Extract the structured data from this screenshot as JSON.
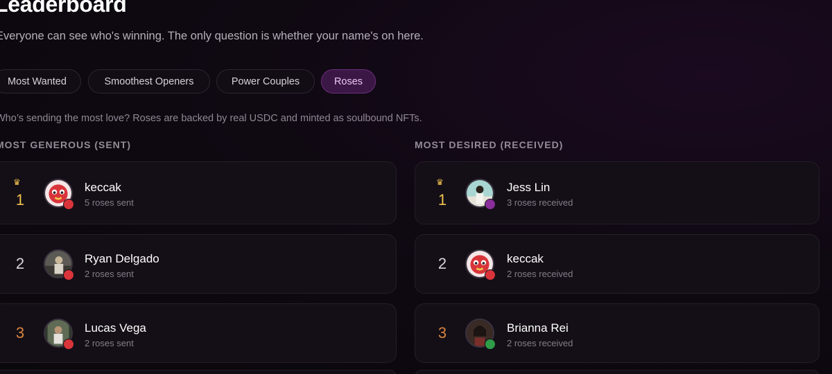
{
  "header": {
    "title": "Leaderboard",
    "subtitle": "Everyone can see who's winning. The only question is whether your name's on here."
  },
  "tabs": [
    {
      "label": "Most Wanted",
      "active": false
    },
    {
      "label": "Smoothest Openers",
      "active": false
    },
    {
      "label": "Power Couples",
      "active": false
    },
    {
      "label": "Roses",
      "active": true
    }
  ],
  "description": "Who’s sending the most love? Roses are backed by real USDC and minted as soulbound NFTs.",
  "sent": {
    "heading": "MOST GENEROUS (SENT)",
    "entries": [
      {
        "rank": "1",
        "name": "keccak",
        "count": "5 roses sent",
        "avatar": "mascot-avatar",
        "badge_color": "#d8343a"
      },
      {
        "rank": "2",
        "name": "Ryan Delgado",
        "count": "2 roses sent",
        "avatar": "photo-avatar",
        "badge_color": "#d8343a"
      },
      {
        "rank": "3",
        "name": "Lucas Vega",
        "count": "2 roses sent",
        "avatar": "photo-avatar",
        "badge_color": "#d8343a"
      }
    ]
  },
  "received": {
    "heading": "MOST DESIRED (RECEIVED)",
    "entries": [
      {
        "rank": "1",
        "name": "Jess Lin",
        "count": "3 roses received",
        "avatar": "photo-avatar",
        "badge_color": "#8a2e9c"
      },
      {
        "rank": "2",
        "name": "keccak",
        "count": "2 roses received",
        "avatar": "mascot-avatar",
        "badge_color": "#d8343a"
      },
      {
        "rank": "3",
        "name": "Brianna Rei",
        "count": "2 roses received",
        "avatar": "photo-avatar",
        "badge_color": "#2e9c48"
      }
    ]
  },
  "colors": {
    "accent": "#3a1745",
    "gold": "#f2c34d",
    "bronze": "#d9843e"
  }
}
